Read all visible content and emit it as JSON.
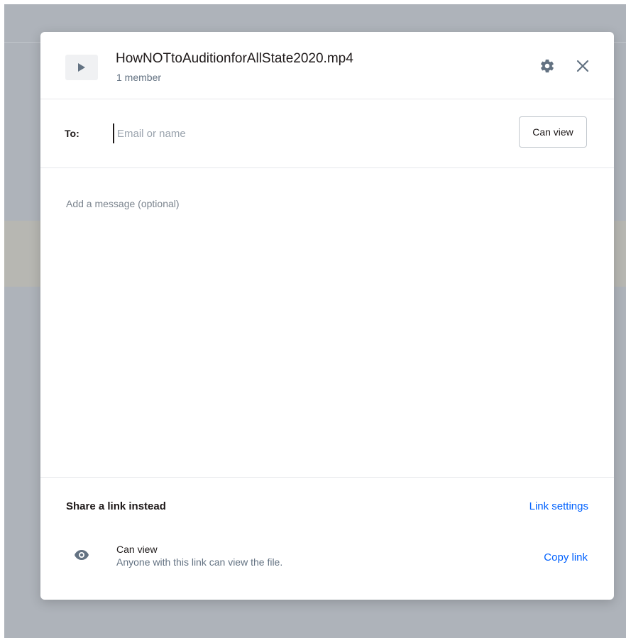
{
  "file": {
    "name": "HowNOTtoAuditionforAllState2020.mp4",
    "members": "1 member",
    "thumb_icon": "play-icon"
  },
  "header_actions": {
    "settings_icon": "gear-icon",
    "close_icon": "close-icon"
  },
  "to_row": {
    "label": "To:",
    "placeholder": "Email or name",
    "permission": "Can view"
  },
  "message": {
    "placeholder": "Add a message (optional)"
  },
  "share_link": {
    "title": "Share a link instead",
    "settings_label": "Link settings",
    "access_icon": "eye-icon",
    "access_title": "Can view",
    "access_description": "Anyone with this link can view the file.",
    "copy_label": "Copy link"
  },
  "colors": {
    "link": "#0061fe",
    "backdrop": "#aeb3ba",
    "text": "#1e1919",
    "muted": "#637282"
  }
}
